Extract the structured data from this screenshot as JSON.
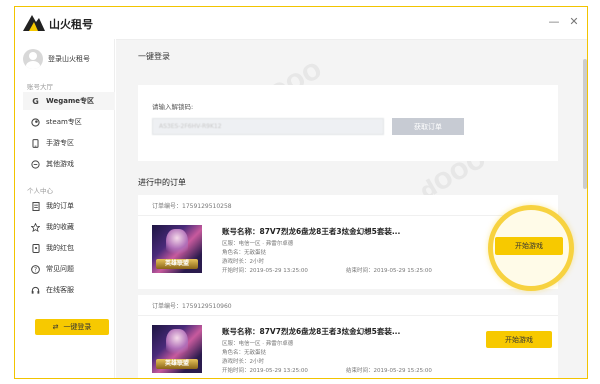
{
  "app": {
    "title": "山火租号",
    "brand_color": "#F7C900",
    "window_controls": [
      "—",
      "✕"
    ]
  },
  "sidebar": {
    "user_label": "登录山火租号",
    "section_account": "账号大厅",
    "account_items": [
      {
        "label": "Wegame专区",
        "icon": "G",
        "active": true
      },
      {
        "label": "steam专区",
        "icon": "steam-icon"
      },
      {
        "label": "手游专区",
        "icon": "phone-icon"
      },
      {
        "label": "其他游戏",
        "icon": "gamepad-icon"
      }
    ],
    "section_personal": "个人中心",
    "personal_items": [
      {
        "label": "我的订单",
        "icon": "order-icon"
      },
      {
        "label": "我的收藏",
        "icon": "star-icon"
      },
      {
        "label": "我的红包",
        "icon": "wallet-icon"
      },
      {
        "label": "常见问题",
        "icon": "question-icon"
      },
      {
        "label": "在线客服",
        "icon": "support-icon"
      }
    ],
    "login_button": "一键登录"
  },
  "main": {
    "title": "一键登录",
    "input_label": "请输入解锁码:",
    "input_value": "AS3ES-2F6HV-R9K12",
    "fetch_button": "获取订单",
    "orders_title": "进行中的订单",
    "orders": [
      {
        "order_no": "订单编号：1759129510258",
        "account_name": "账号名称：87V7烈龙6盘龙8王者3炫金幻想5套装...",
        "region": "区服：电信一区 · 弗雷尔卓德",
        "role": "角色名：无敌蛋挞",
        "duration": "游戏时长：2小时",
        "start_time": "开始时间：2019-05-29 13:25:00",
        "end_time": "结束时间：2019-05-29 15:25:00",
        "thumb_badge": "英雄联盟",
        "start_button": "开始游戏"
      },
      {
        "order_no": "订单编号：1759129510960",
        "account_name": "账号名称：87V7烈龙6盘龙8王者3炫金幻想5套装...",
        "region": "区服：电信一区 · 弗雷尔卓德",
        "role": "角色名：无敌蛋挞",
        "duration": "游戏时长：2小时",
        "start_time": "开始时间：2019-05-29 13:25:00",
        "end_time": "结束时间：2019-05-29 15:25:00",
        "thumb_badge": "英雄联盟",
        "start_button": "开始游戏"
      }
    ]
  }
}
